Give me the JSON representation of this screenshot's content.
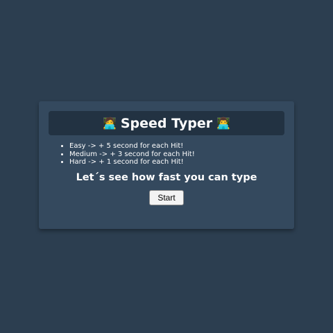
{
  "header": {
    "icon_left": "🧑‍💻",
    "title": "Speed Typer",
    "icon_right": "👨‍💻"
  },
  "rules": [
    "Easy -> + 5 second for each Hit!",
    "Medium -> + 3 second for each Hit!",
    "Hard -> + 1 second for each Hit!"
  ],
  "tagline": "Let´s see how fast you can type",
  "start_button": "Start"
}
